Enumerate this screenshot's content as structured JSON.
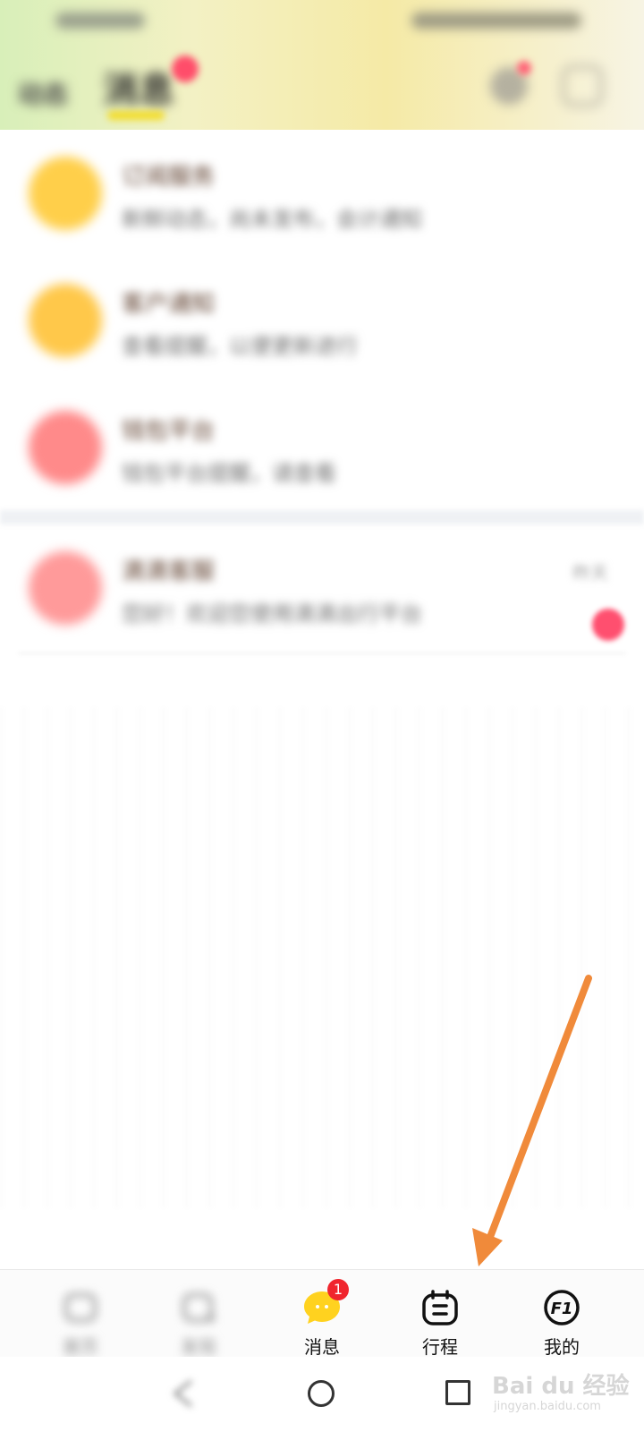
{
  "header": {
    "tabs": [
      {
        "label": "动态"
      },
      {
        "label": "消息"
      }
    ],
    "accent": "#f3dc28",
    "badge_color": "#ff4d6a",
    "icons": [
      "bell-icon",
      "profile-icon"
    ]
  },
  "messages": [
    {
      "title": "订阅服务",
      "subtitle": "新鲜动态，尚未发布，会计通知",
      "avatar_color": "#ffcf4a",
      "icon": "subscription-icon"
    },
    {
      "title": "客户通知",
      "subtitle": "查看提醒，以便更新进行",
      "avatar_color": "#ffc84a",
      "icon": "notice-icon"
    },
    {
      "title": "钱包平台",
      "subtitle": "钱包平台提醒，请查看",
      "avatar_color": "#ff8a8a",
      "icon": "wallet-icon"
    },
    {
      "title": "滴滴客服",
      "subtitle": "您好！欢迎您使用滴滴出行平台",
      "time": "昨天",
      "avatar_color": "#ff9a9a",
      "unread": true,
      "icon": "support-icon"
    }
  ],
  "bottom_nav": {
    "items": [
      {
        "label": "首页",
        "icon": "home-icon",
        "blurred": true
      },
      {
        "label": "发现",
        "icon": "discover-icon",
        "blurred": true
      },
      {
        "label": "消息",
        "icon": "message-icon",
        "badge": "1",
        "active": true
      },
      {
        "label": "行程",
        "icon": "trip-icon"
      },
      {
        "label": "我的",
        "icon": "profile-f1-icon"
      }
    ],
    "active_color": "#ffd21f",
    "badge_color": "#f0252d"
  },
  "system_nav": {
    "buttons": [
      "back-icon",
      "home-circle-icon",
      "recent-apps-icon"
    ]
  },
  "annotation": {
    "arrow_color": "#f08a3a",
    "points_to": "行程"
  },
  "watermark": {
    "text": "Bai du 经验",
    "sub": "jingyan.baidu.com"
  }
}
